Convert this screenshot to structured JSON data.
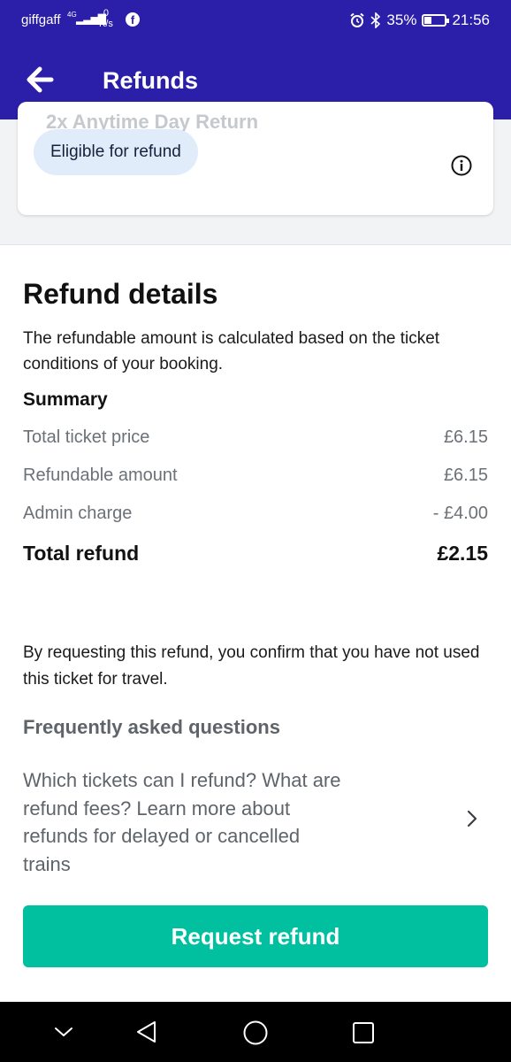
{
  "status_bar": {
    "carrier": "giffgaff",
    "network": "4G",
    "speed_value": "0",
    "speed_unit": "K/s",
    "battery": "35%",
    "battery_level": 0.35,
    "time": "21:56"
  },
  "app_bar": {
    "title": "Refunds"
  },
  "ticket_card": {
    "ticket_name": "2x Anytime Day Return",
    "eligibility_badge": "Eligible for refund"
  },
  "refund_details": {
    "heading": "Refund details",
    "description": "The refundable amount is calculated based on the ticket conditions of your booking.",
    "summary_heading": "Summary",
    "rows": [
      {
        "label": "Total ticket price",
        "value": "£6.15"
      },
      {
        "label": "Refundable amount",
        "value": "£6.15"
      },
      {
        "label": "Admin charge",
        "value": "- £4.00"
      }
    ],
    "total": {
      "label": "Total refund",
      "value": "£2.15"
    }
  },
  "confirmation_text": "By requesting this refund, you confirm that you have not used this ticket for travel.",
  "faq": {
    "heading": "Frequently asked questions",
    "link_text": "Which tickets can I refund? What are refund fees? Learn more about refunds for delayed or cancelled trains"
  },
  "cta": {
    "label": "Request refund"
  },
  "colors": {
    "app_bar": "#2b1ea8",
    "cta": "#00c0a0",
    "badge_bg": "#e1ecfb"
  }
}
